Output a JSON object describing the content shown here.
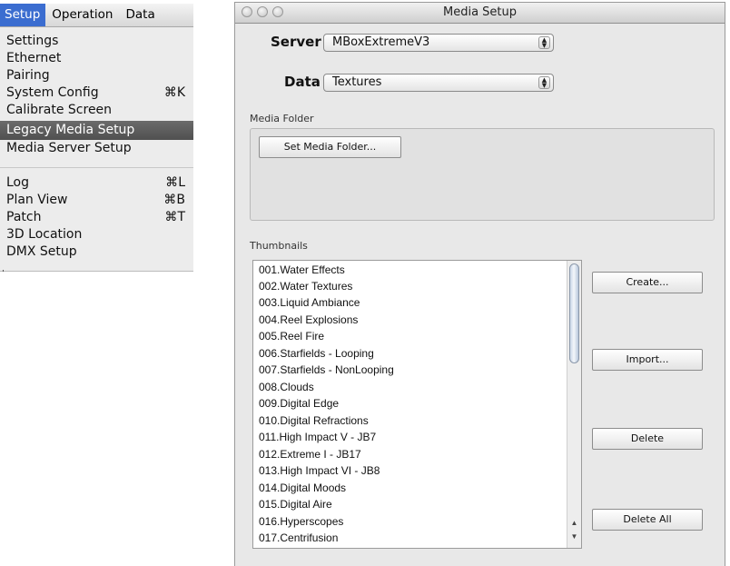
{
  "menu": {
    "bar": [
      "Setup",
      "Operation",
      "Data"
    ],
    "items": [
      {
        "label": "Settings",
        "shortcut": ""
      },
      {
        "label": "Ethernet",
        "shortcut": ""
      },
      {
        "label": "Pairing",
        "shortcut": ""
      },
      {
        "label": "System Config",
        "shortcut": "⌘K"
      },
      {
        "label": "Calibrate Screen",
        "shortcut": ""
      },
      {
        "label": "Legacy Media Setup",
        "shortcut": ""
      },
      {
        "label": "Media Server Setup",
        "shortcut": ""
      },
      {
        "label": "Log",
        "shortcut": "⌘L"
      },
      {
        "label": "Plan View",
        "shortcut": "⌘B"
      },
      {
        "label": "Patch",
        "shortcut": "⌘T"
      },
      {
        "label": "3D Location",
        "shortcut": ""
      },
      {
        "label": "DMX Setup",
        "shortcut": ""
      }
    ]
  },
  "window": {
    "title": "Media Setup",
    "server": {
      "label": "Server",
      "value": "MBoxExtremeV3"
    },
    "data": {
      "label": "Data",
      "value": "Textures"
    },
    "media_folder": {
      "label": "Media Folder",
      "button": "Set Media Folder..."
    },
    "thumbnails": {
      "label": "Thumbnails",
      "items": [
        "001.Water Effects",
        "002.Water Textures",
        "003.Liquid Ambiance",
        "004.Reel Explosions",
        "005.Reel Fire",
        "006.Starfields - Looping",
        "007.Starfields - NonLooping",
        "008.Clouds",
        "009.Digital Edge",
        "010.Digital Refractions",
        "011.High Impact V - JB7",
        "012.Extreme I - JB17",
        "013.High Impact VI - JB8",
        "014.Digital Moods",
        "015.Digital Aire",
        "016.Hyperscopes",
        "017.Centrifusion"
      ],
      "buttons": {
        "create": "Create...",
        "import": "Import...",
        "delete": "Delete",
        "delete_all": "Delete All"
      }
    }
  }
}
